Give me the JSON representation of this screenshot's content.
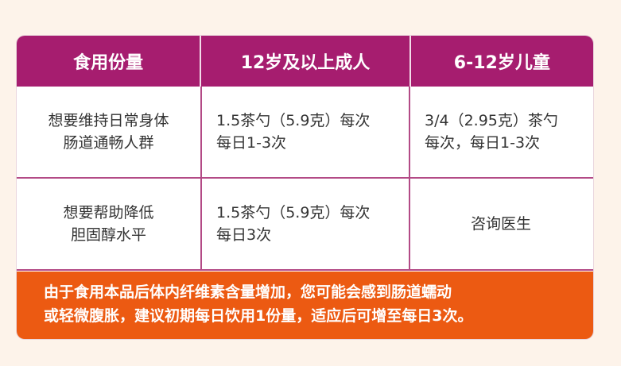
{
  "table": {
    "headers": [
      "食用份量",
      "12岁及以上成人",
      "6-12岁儿童"
    ],
    "rows": [
      {
        "purpose": [
          "想要维持日常身体",
          "肠道通畅人群"
        ],
        "adult": [
          "1.5茶勺（5.9克）每次",
          "每日1-3次"
        ],
        "child": [
          "3/4（2.95克）茶勺",
          "每次，每日1-3次"
        ]
      },
      {
        "purpose": [
          "想要帮助降低",
          "胆固醇水平"
        ],
        "adult": [
          "1.5茶勺（5.9克）每次",
          "每日3次"
        ],
        "child": [
          "咨询医生"
        ]
      }
    ]
  },
  "note": {
    "lines": [
      "由于食用本品后体内纤维素含量增加，您可能会感到肠道蠕动",
      "或轻微腹胀，建议初期每日饮用1份量，适应后可增至每日3次。"
    ]
  },
  "colors": {
    "header_bg": "#a61d6f",
    "footer_bg": "#ec5a12",
    "page_bg": "#fdf3ea",
    "grid_line": "#b34a86"
  }
}
